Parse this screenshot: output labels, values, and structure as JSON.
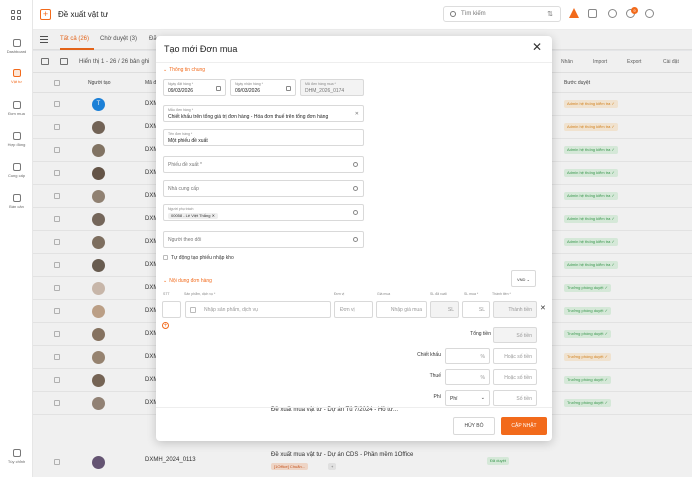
{
  "app": {
    "title": "Đề xuất vật tư"
  },
  "rail": {
    "items": [
      {
        "label": "Dashboard"
      },
      {
        "label": "Vật tư"
      },
      {
        "label": "Đơn mua"
      },
      {
        "label": "Hợp đồng"
      },
      {
        "label": "Cung cấp"
      },
      {
        "label": "Bán cân"
      }
    ],
    "bottom": "Tùy chỉnh"
  },
  "search": {
    "placeholder": "Tìm kiếm"
  },
  "notifications": {
    "count": "9"
  },
  "tabs": [
    {
      "label": "Tất cả (26)"
    },
    {
      "label": "Chờ duyệt (3)"
    },
    {
      "label": "Đã"
    }
  ],
  "toolbar": {
    "range": "Hiển thị 1 - 26 / 26 bản ghi",
    "actions": [
      "Nhân",
      "Import",
      "Export",
      "Cài đặt"
    ]
  },
  "table": {
    "headers": {
      "creator": "Người tạo",
      "code": "Mã đ",
      "step": "Bước duyệt"
    },
    "rows": [
      {
        "initial": "T",
        "code": "DXM",
        "status": "Admin hệ thống kiểm tra ✓",
        "tone": "orange"
      },
      {
        "initial": "",
        "code": "DXM",
        "status": "Admin hệ thống kiểm tra ✓",
        "tone": "orange"
      },
      {
        "initial": "",
        "code": "DXM",
        "status": "Admin hệ thống kiểm tra ✓",
        "tone": "green"
      },
      {
        "initial": "",
        "code": "DXM",
        "status": "Admin hệ thống kiểm tra ✓",
        "tone": "green"
      },
      {
        "initial": "",
        "code": "DXM",
        "status": "Admin hệ thống kiểm tra ✓",
        "tone": "green"
      },
      {
        "initial": "",
        "code": "DXM",
        "status": "Admin hệ thống kiểm tra ✓",
        "tone": "green"
      },
      {
        "initial": "",
        "code": "DXM",
        "status": "Admin hệ thống kiểm tra ✓",
        "tone": "green"
      },
      {
        "initial": "",
        "code": "DXM",
        "status": "Admin hệ thống kiểm tra ✓",
        "tone": "green"
      },
      {
        "initial": "",
        "code": "DXM",
        "status": "Trưởng phòng duyệt ✓",
        "tone": "green"
      },
      {
        "initial": "",
        "code": "DXM",
        "status": "Trưởng phòng duyệt ✓",
        "tone": "green"
      },
      {
        "initial": "",
        "code": "DXM",
        "status": "Trưởng phòng duyệt ✓",
        "tone": "green"
      },
      {
        "initial": "",
        "code": "DXM",
        "status": "Trưởng phòng duyệt ✓",
        "tone": "orange"
      },
      {
        "initial": "",
        "code": "DXM",
        "status": "Trưởng phòng duyệt ✓",
        "tone": "green"
      },
      {
        "initial": "",
        "code": "DXM",
        "status": "Trưởng phòng duyệt ✓",
        "tone": "green"
      }
    ],
    "last": {
      "code": "DXMH_2024_0113",
      "desc": "Đề xuất mua vật tư - Dự án CDS - Phần mềm 1Office",
      "tag": "[1Office] Chuẩn...",
      "tag_more": "+",
      "status": "Đã duyệt"
    }
  },
  "modal": {
    "title": "Tạo mới Đơn mua",
    "section_general": "Thông tin chung",
    "order_date": {
      "label": "Ngày đặt hàng *",
      "value": "09/03/2026"
    },
    "receive_date": {
      "label": "Ngày nhận hàng *",
      "value": "09/03/2026"
    },
    "order_code": {
      "label": "Mã đơn hàng mua *",
      "value": "DHM_2026_0174"
    },
    "template": {
      "label": "Mẫu đơn hàng *",
      "value": "Chiết khấu trên tổng giá trị đơn hàng - Hóa đơn thuế trên tổng đơn hàng"
    },
    "name": {
      "label": "Tên đơn hàng *",
      "value": "Một phiếu đề xuất"
    },
    "proposal": {
      "placeholder": "Phiếu đề xuất *"
    },
    "supplier": {
      "placeholder": "Nhà cung cấp"
    },
    "owner": {
      "label": "Người phụ trách",
      "value": "00058 - Lê Việt Thắng"
    },
    "follower": {
      "placeholder": "Người theo dõi"
    },
    "auto_receipt": "Tự động tạo phiếu nhập kho",
    "section_content": "Nội dung đơn hàng",
    "currency": "VND",
    "columns": {
      "stt": "STT",
      "product": "Sản phẩm, dịch vụ *",
      "unit": "Đơn vị",
      "price": "Giá mua",
      "qty_ordered": "SL đã xuất",
      "qty_buy": "SL mua *",
      "amount": "Thành tiền *"
    },
    "line": {
      "product_ph": "Nhập sản phẩm, dịch vụ",
      "unit_ph": "Đơn vị",
      "price_ph": "Nhập giá mua",
      "qty_ordered_ph": "SL",
      "qty_ph": "SL",
      "amount_ph": "Thành tiền"
    },
    "totals": {
      "total_label": "Tổng tiền",
      "total_ph": "Số tiền",
      "discount_label": "Chiết khấu",
      "discount_pct": "%",
      "discount_ph": "Hoặc số tiền",
      "tax_label": "Thuế",
      "tax_pct": "%",
      "tax_ph": "Hoặc số tiền",
      "fee_label": "Phí",
      "fee_select": "Phí",
      "fee_ph": "Số tiền"
    },
    "peek": "Đề xuất mua vật tư - Dự án Tủ 7/2024 - Hồ tư...",
    "cancel": "HỦY BỎ",
    "save": "CẬP NHẬT"
  }
}
